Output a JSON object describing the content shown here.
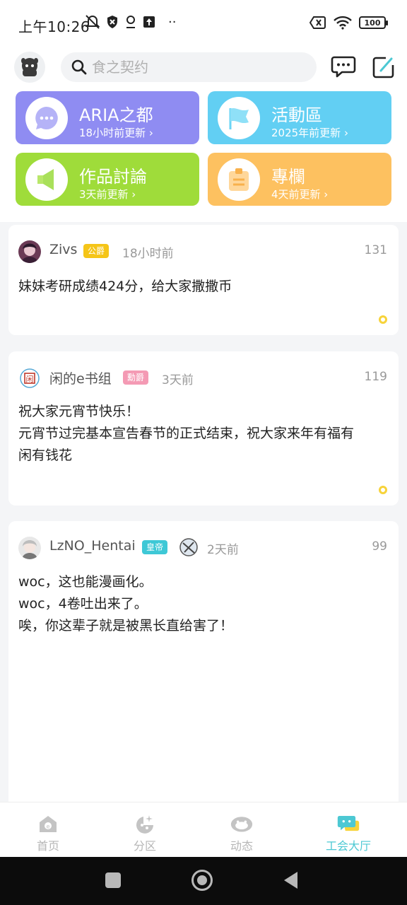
{
  "status_bar": {
    "time": "上午10:26",
    "battery": "100"
  },
  "header": {
    "search_placeholder": "食之契约"
  },
  "categories": [
    {
      "title": "ARIA之都",
      "subtitle": "18小时前更新 ›",
      "color": "#8f8cf2",
      "icon": "speech-bubble-icon"
    },
    {
      "title": "活動區",
      "subtitle": "2025年前更新 ›",
      "color": "#62cff3",
      "icon": "flag-icon"
    },
    {
      "title": "作品討論",
      "subtitle": "3天前更新 ›",
      "color": "#9fdc3a",
      "icon": "megaphone-icon"
    },
    {
      "title": "專欄",
      "subtitle": "4天前更新 ›",
      "color": "#fdc160",
      "icon": "notebook-icon"
    }
  ],
  "posts": [
    {
      "author": "Zivs",
      "badge": "公爵",
      "badge_color": "#f5c518",
      "time": "18小时前",
      "count": "131",
      "lines": [
        "妹妹考研成绩424分，给大家撒撒币"
      ]
    },
    {
      "author": "闲的e书组",
      "badge": "勳爵",
      "badge_color": "#f49ab4",
      "time": "3天前",
      "count": "119",
      "lines": [
        "祝大家元宵节快乐！",
        "元宵节过完基本宣告春节的正式结束，祝大家来年有福有",
        "闲有钱花"
      ]
    },
    {
      "author": "LzNO_Hentai",
      "badge": "皇帝",
      "badge_color": "#3ec8d6",
      "time": "2天前",
      "count": "99",
      "lines": [
        "woc，这也能漫画化。",
        "woc，4卷吐出来了。",
        "唉，你这辈子就是被黑长直给害了！"
      ]
    }
  ],
  "bottom_nav": [
    {
      "label": "首页",
      "icon": "home-icon",
      "active": false
    },
    {
      "label": "分区",
      "icon": "category-icon",
      "active": false
    },
    {
      "label": "动态",
      "icon": "feed-icon",
      "active": false
    },
    {
      "label": "工会大厅",
      "icon": "guild-hall-icon",
      "active": true
    }
  ],
  "colors": {
    "accent": "#4cc8d3",
    "dot": "#f7d33a"
  }
}
